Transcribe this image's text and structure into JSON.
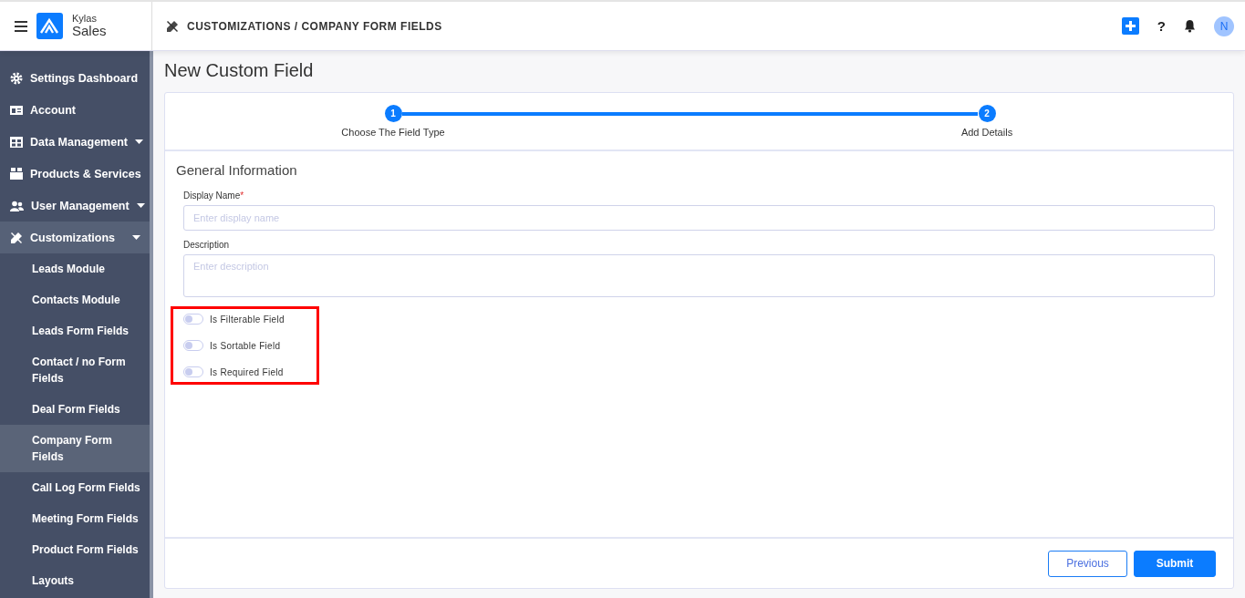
{
  "brand": {
    "name": "Kylas",
    "product": "Sales"
  },
  "breadcrumb": "CUSTOMIZATIONS / COMPANY FORM FIELDS",
  "header": {
    "help": "?",
    "avatar": "N"
  },
  "sidebar": {
    "items": [
      {
        "label": "Settings Dashboard",
        "has_menu": false,
        "expanded": false
      },
      {
        "label": "Account",
        "has_menu": false,
        "expanded": false
      },
      {
        "label": "Data Management",
        "has_menu": true,
        "expanded": false
      },
      {
        "label": "Products & Services",
        "has_menu": false,
        "expanded": false
      },
      {
        "label": "User Management",
        "has_menu": true,
        "expanded": false
      },
      {
        "label": "Customizations",
        "has_menu": true,
        "expanded": true,
        "children": [
          {
            "label": "Leads Module",
            "selected": false
          },
          {
            "label": "Contacts Module",
            "selected": false
          },
          {
            "label": "Leads Form Fields",
            "selected": false
          },
          {
            "label": "Contact / no Form Fields",
            "selected": false
          },
          {
            "label": "Deal Form Fields",
            "selected": false
          },
          {
            "label": "Company Form Fields",
            "selected": true
          },
          {
            "label": "Call Log Form Fields",
            "selected": false
          },
          {
            "label": "Meeting Form Fields",
            "selected": false
          },
          {
            "label": "Product Form Fields",
            "selected": false
          },
          {
            "label": "Layouts",
            "selected": false
          }
        ]
      }
    ]
  },
  "page_title": "New Custom Field",
  "steps": [
    {
      "number": "1",
      "label": "Choose The Field Type",
      "done": true
    },
    {
      "number": "2",
      "label": "Add Details",
      "done": true
    }
  ],
  "section_title": "General Information",
  "fields": [
    {
      "label": "Display Name",
      "required_mark": "*",
      "placeholder": "Enter display name",
      "kind": "input"
    },
    {
      "label": "Description",
      "placeholder": "Enter description",
      "kind": "textarea"
    }
  ],
  "toggles": [
    {
      "label": "Is Filterable Field",
      "on": false
    },
    {
      "label": "Is Sortable Field",
      "on": false
    },
    {
      "label": "Is Required Field",
      "on": false
    }
  ],
  "buttons": {
    "previous": "Previous",
    "submit": "Submit"
  }
}
